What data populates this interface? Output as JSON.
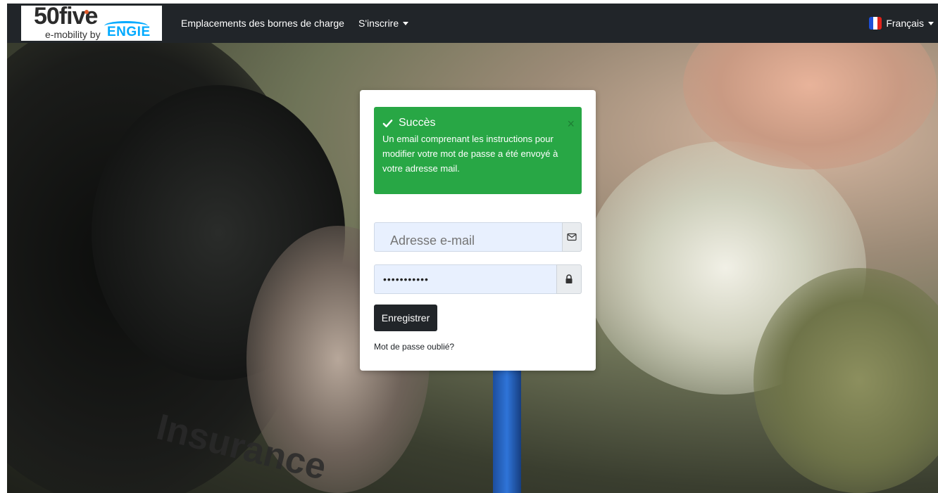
{
  "brand": {
    "logo_main": "50five",
    "logo_sub": "e-mobility by",
    "logo_engie": "ENGIE"
  },
  "nav": {
    "links": [
      {
        "label": "Emplacements des bornes de charge"
      },
      {
        "label": "S'inscrire"
      }
    ],
    "language": "Français",
    "flag_colors": [
      "#1e4fd6",
      "#ffffff",
      "#e0231b"
    ]
  },
  "alert": {
    "title": "Succès",
    "message": "Un email comprenant les instructions pour modifier votre mot de passe a été envoyé à votre adresse mail.",
    "close": "×",
    "color": "#28a745"
  },
  "form": {
    "email_placeholder": "Adresse e-mail",
    "password_value": "•••••••••••",
    "submit_label": "Enregistrer",
    "forgot_label": "Mot de passe oublié?"
  },
  "icons": {
    "email": "envelope-icon",
    "password": "lock-icon",
    "success": "check-icon"
  }
}
